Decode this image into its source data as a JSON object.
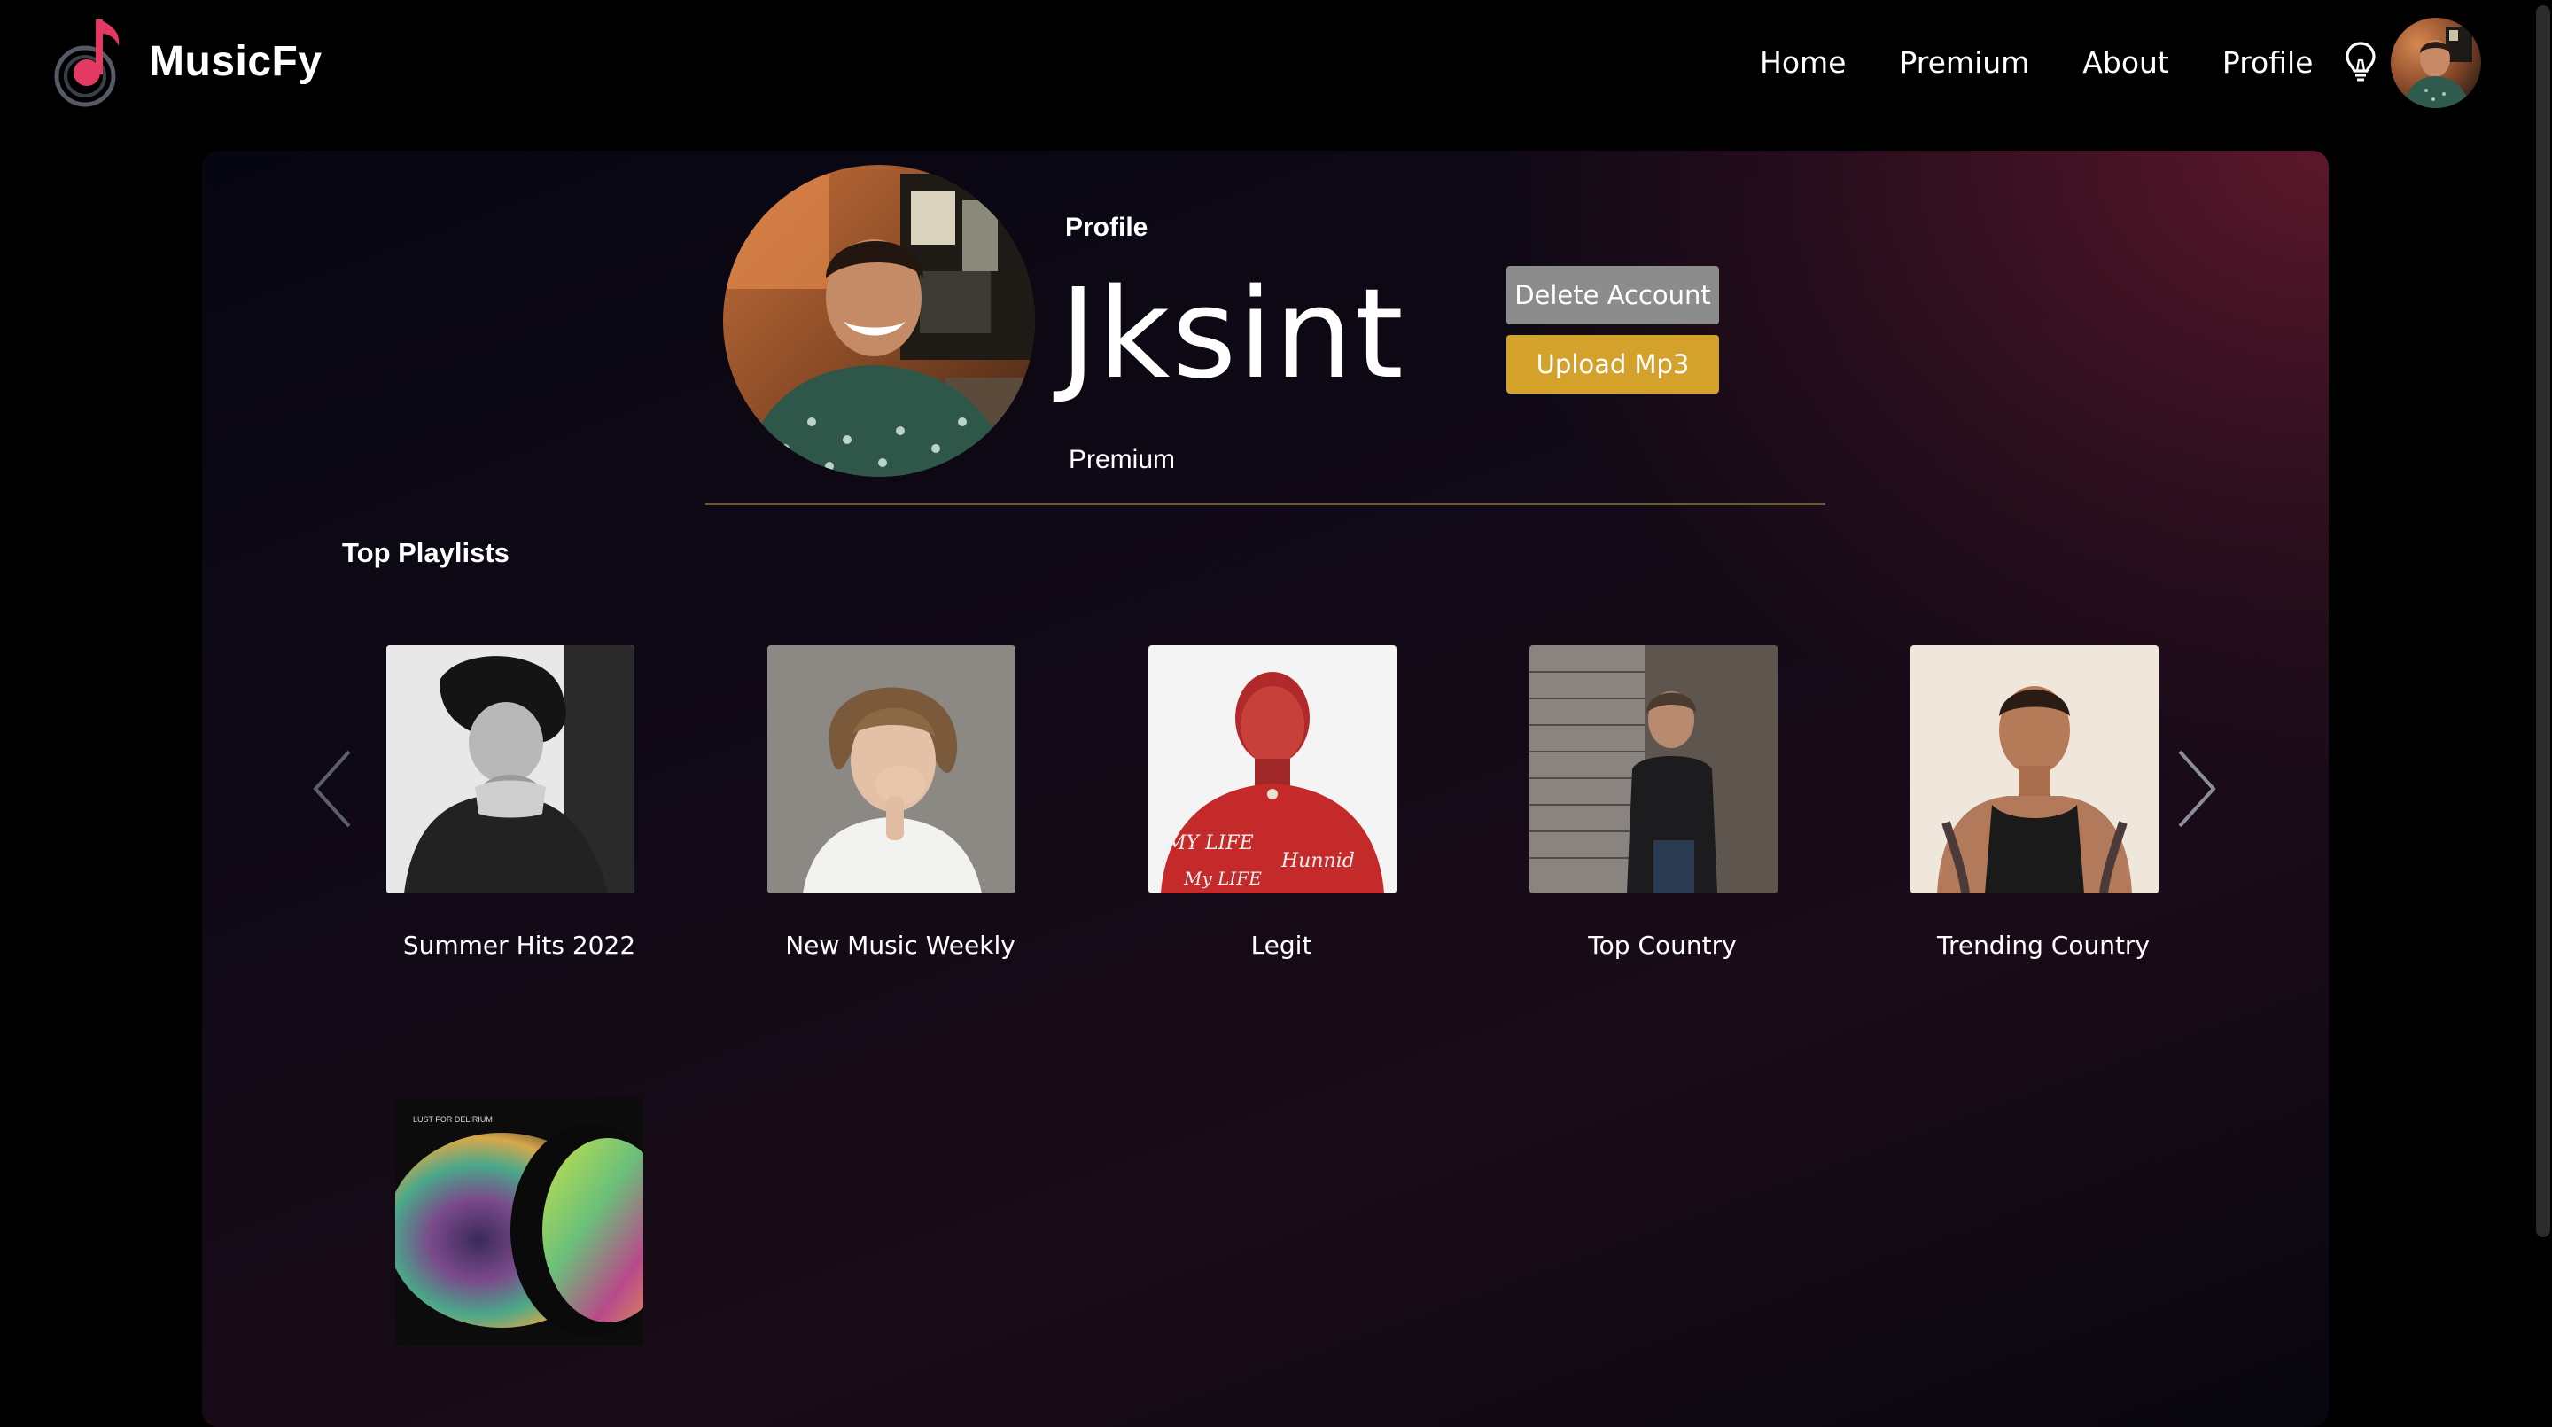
{
  "app": {
    "name": "MusicFy",
    "accent": "#c8294e"
  },
  "nav": {
    "links": [
      "Home",
      "Premium",
      "About",
      "Profile"
    ],
    "icons": [
      "lightbulb-icon"
    ],
    "avatar": "user-avatar"
  },
  "profile": {
    "label": "Profile",
    "username": "Jksint",
    "tier": "Premium",
    "delete_label": "Delete Account",
    "upload_label": "Upload Mp3",
    "delete_color": "#8c8c8c",
    "upload_color": "#d4a12b"
  },
  "playlists": {
    "title": "Top Playlists",
    "items": [
      {
        "title": "Summer Hits 2022"
      },
      {
        "title": "New Music Weekly"
      },
      {
        "title": "Legit"
      },
      {
        "title": "Top Country"
      },
      {
        "title": "Trending Country"
      }
    ],
    "second_row_cover_text": "LUST FOR DELIRIUM"
  }
}
